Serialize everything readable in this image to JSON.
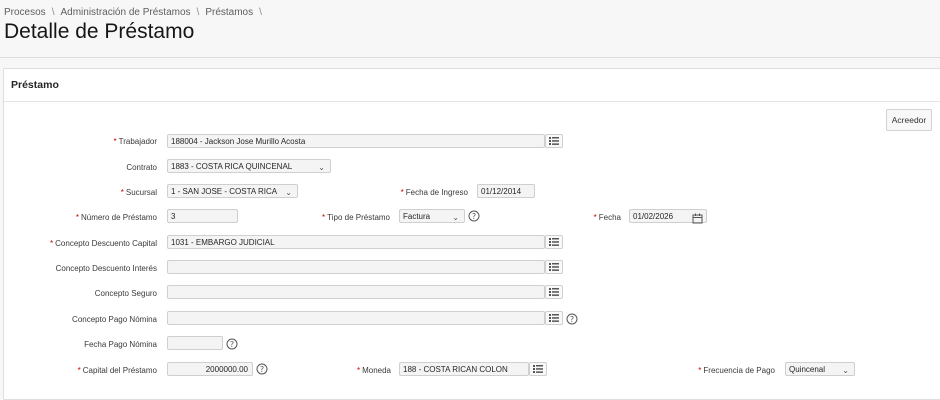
{
  "breadcrumb": {
    "items": [
      "Procesos",
      "Administración de Préstamos",
      "Préstamos"
    ],
    "separator": "\\"
  },
  "page": {
    "title": "Detalle de Préstamo"
  },
  "panel": {
    "title": "Préstamo",
    "button_label": "Acreedor"
  },
  "colors": {
    "required": "#cc0000",
    "field_bg": "#f4f4f4",
    "border": "#cfcfcf"
  },
  "form": {
    "trabajador": {
      "label": "Trabajador",
      "required": true,
      "value": "188004 - Jackson Jose Murillo Acosta",
      "icon": "list-icon"
    },
    "contrato": {
      "label": "Contrato",
      "required": false,
      "value": "1883 - COSTA RICA QUINCENAL"
    },
    "sucursal": {
      "label": "Sucursal",
      "required": true,
      "value": "1 - SAN JOSE - COSTA RICA"
    },
    "fecha_ingreso": {
      "label": "Fecha de Ingreso",
      "required": true,
      "value": "01/12/2014"
    },
    "numero_prestamo": {
      "label": "Número de Préstamo",
      "required": true,
      "value": "3"
    },
    "tipo_prestamo": {
      "label": "Tipo de Préstamo",
      "required": true,
      "value": "Factura"
    },
    "fecha": {
      "label": "Fecha",
      "required": true,
      "value": "01/02/2026",
      "icon": "calendar-icon"
    },
    "concepto_capital": {
      "label": "Concepto Descuento Capital",
      "required": true,
      "value": "1031 - EMBARGO JUDICIAL"
    },
    "concepto_interes": {
      "label": "Concepto Descuento Interés",
      "required": false,
      "value": ""
    },
    "concepto_seguro": {
      "label": "Concepto Seguro",
      "required": false,
      "value": ""
    },
    "concepto_pago_nomina": {
      "label": "Concepto Pago Nómina",
      "required": false,
      "value": ""
    },
    "fecha_pago_nomina": {
      "label": "Fecha Pago Nómina",
      "required": false,
      "value": ""
    },
    "capital_prestamo": {
      "label": "Capital del Préstamo",
      "required": true,
      "value": "2000000.00"
    },
    "moneda": {
      "label": "Moneda",
      "required": true,
      "value": "188 - COSTA RICAN COLON"
    },
    "frecuencia_pago": {
      "label": "Frecuencia de Pago",
      "required": true,
      "value": "Quincenal"
    }
  }
}
